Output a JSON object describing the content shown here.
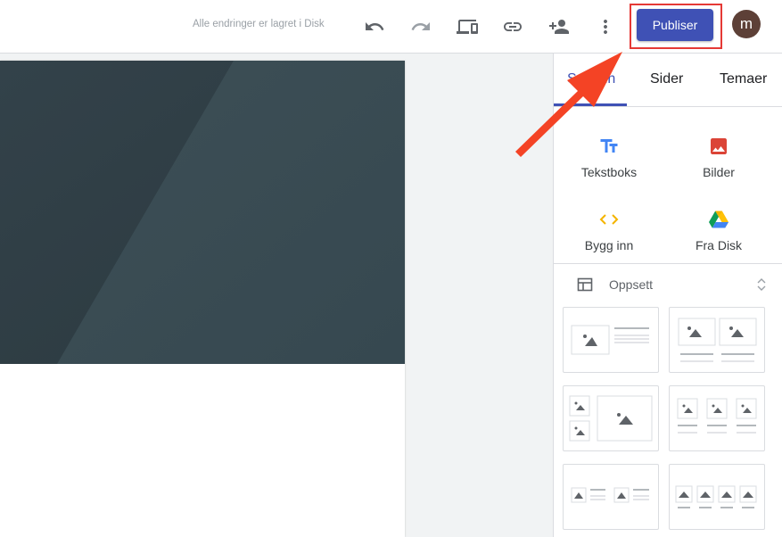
{
  "topbar": {
    "save_status": "Alle endringer er lagret i Disk",
    "icons": [
      "undo-icon",
      "redo-icon",
      "preview-devices-icon",
      "link-icon",
      "add-person-icon",
      "more-vert-icon"
    ],
    "publish_label": "Publiser",
    "avatar_letter": "m",
    "colors": {
      "publish": "#3f51b5",
      "avatar": "#5d4037",
      "highlight": "#e53935"
    }
  },
  "panel": {
    "tabs": [
      {
        "label": "Sett inn",
        "active": true
      },
      {
        "label": "Sider",
        "active": false
      },
      {
        "label": "Temaer",
        "active": false
      }
    ],
    "insert_items": [
      {
        "label": "Tekstboks",
        "icon": "text-box-icon"
      },
      {
        "label": "Bilder",
        "icon": "image-icon"
      },
      {
        "label": "Bygg inn",
        "icon": "embed-code-icon"
      },
      {
        "label": "Fra Disk",
        "icon": "google-drive-icon"
      }
    ],
    "layouts_label": "Oppsett"
  },
  "annotation": {
    "color": "#f44325"
  }
}
